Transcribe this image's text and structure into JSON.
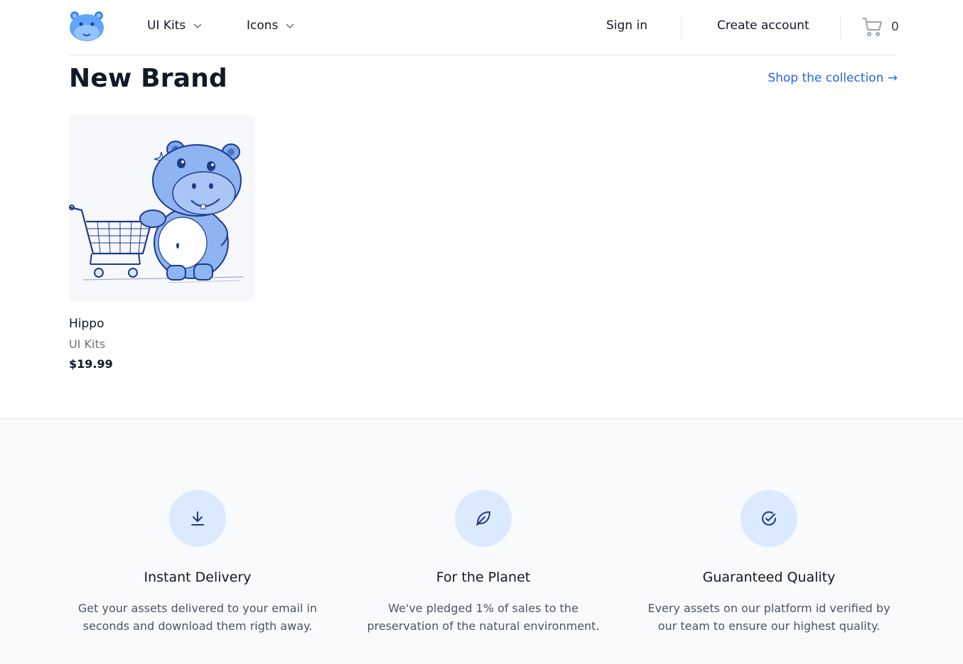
{
  "header": {
    "nav": [
      {
        "label": "UI Kits"
      },
      {
        "label": "Icons"
      }
    ],
    "sign_in": "Sign in",
    "create_account": "Create account",
    "cart_count": "0"
  },
  "section": {
    "title": "New Brand",
    "shop_link": "Shop the collection →"
  },
  "products": [
    {
      "name": "Hippo",
      "category": "UI Kits",
      "price": "$19.99",
      "image": "hippo-with-shopping-cart-illustration"
    }
  ],
  "features": [
    {
      "icon": "download-icon",
      "title": "Instant Delivery",
      "desc": "Get your assets delivered to your email in seconds and download them rigth away."
    },
    {
      "icon": "leaf-icon",
      "title": "For the Planet",
      "desc": "We've pledged 1% of sales to the preservation of the natural environment."
    },
    {
      "icon": "check-circle-icon",
      "title": "Guaranteed Quality",
      "desc": "Every assets on our platform id verified by our team to ensure our highest quality."
    }
  ],
  "colors": {
    "accent": "#2563eb",
    "feature_bg": "#dbeafe",
    "section_bg": "#f9fafb"
  }
}
